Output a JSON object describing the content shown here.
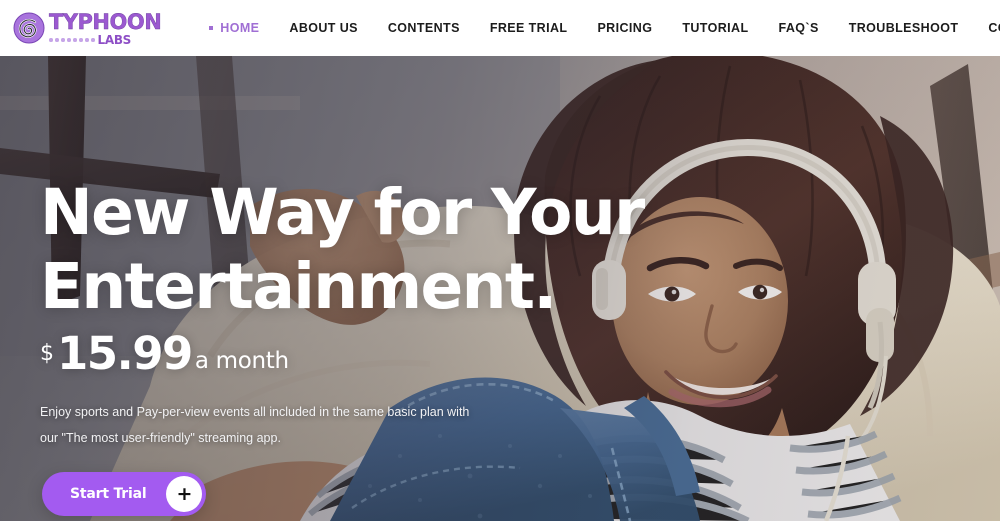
{
  "header": {
    "logo": {
      "icon": "typhoon-spiral-icon",
      "word": "TYPHOON",
      "sub": "LABS",
      "dot_count": 8,
      "color": "#9b59d0"
    },
    "nav": [
      {
        "label": "HOME",
        "active": true
      },
      {
        "label": "ABOUT US",
        "active": false
      },
      {
        "label": "CONTENTS",
        "active": false
      },
      {
        "label": "FREE TRIAL",
        "active": false
      },
      {
        "label": "PRICING",
        "active": false
      },
      {
        "label": "TUTORIAL",
        "active": false
      },
      {
        "label": "FAQ`S",
        "active": false
      },
      {
        "label": "TROUBLESHOOT",
        "active": false
      },
      {
        "label": "CONTACTS",
        "active": false
      }
    ],
    "icons": [
      {
        "name": "shopping-cart-icon"
      },
      {
        "name": "search-icon"
      }
    ],
    "background": "#ffffff",
    "active_color": "#a06fd4"
  },
  "hero": {
    "title_line1": "New Way for Your",
    "title_line2": "Entertainment.",
    "price": {
      "currency": "$",
      "amount": "15.99",
      "period": "a month"
    },
    "description_line1": "Enjoy sports and Pay-per-view events all included in the same basic plan with",
    "description_line2": "our \"The most user-friendly\" streaming app.",
    "cta": {
      "label": "Start Trial",
      "plus": "+",
      "color": "#a35bf0"
    },
    "image_alt": "Smiling woman with curly hair wearing white over-ear headphones, in denim overalls and striped shirt, relaxing on cream cushions"
  }
}
